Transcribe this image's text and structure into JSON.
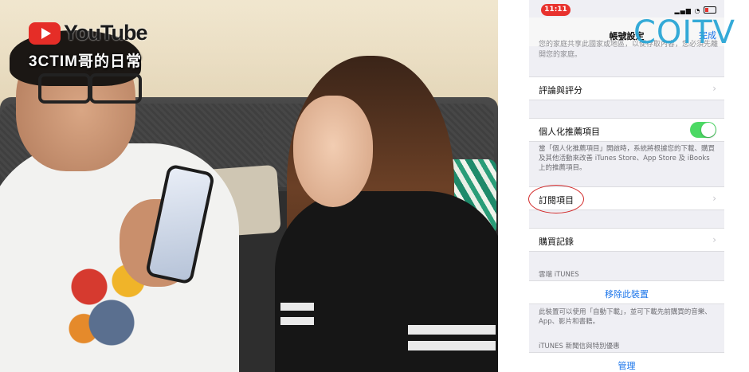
{
  "video": {
    "platform_logo_text": "YouTube",
    "channel_name": "3CTIM哥的日常"
  },
  "watermark": {
    "text": "COITV"
  },
  "phone": {
    "status": {
      "time": "11:11"
    },
    "nav": {
      "title": "帳號設定",
      "done_label": "完成"
    },
    "top_cutoff_text": "您的家庭共享此國家或地區，以便存取內容，您必須先離開您的家庭。",
    "rows": {
      "ratings": {
        "label": "評論與評分"
      },
      "personalized": {
        "label": "個人化推薦項目",
        "toggle_on": true
      },
      "personalized_footnote": "當「個人化推薦項目」開啟時，系統將根據您的下載、購買及其他活動來改善 iTunes Store、App Store 及 iBooks 上的推薦項目。",
      "subscriptions": {
        "label": "訂閱項目"
      },
      "purchase_history": {
        "label": "購買記錄"
      }
    },
    "cloud_section": {
      "header": "雲端 iTUNES",
      "remove_device_label": "移除此裝置",
      "footnote": "此裝置可以使用「自動下載」，並可下載先前購買的音樂、App、影片和書籍。"
    },
    "newsletter_section": {
      "header": "iTUNES 新聞信與特別優惠",
      "manage_label": "管理"
    }
  }
}
